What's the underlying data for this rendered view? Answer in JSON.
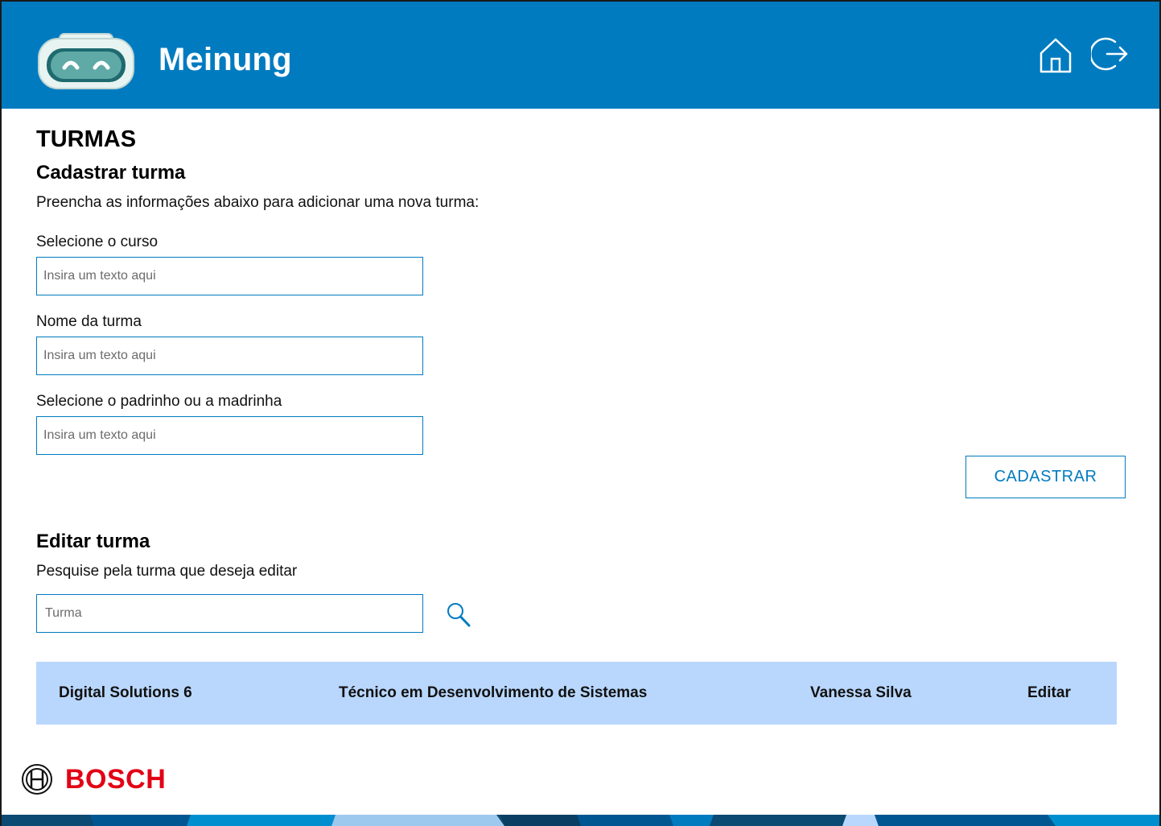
{
  "header": {
    "app_title": "Meinung",
    "home_icon": "home-icon",
    "logout_icon": "logout-icon",
    "background_color": "#007bc0"
  },
  "page": {
    "title": "TURMAS"
  },
  "register_section": {
    "title": "Cadastrar turma",
    "description": "Preencha as informações abaixo para adicionar uma nova turma:",
    "course_label": "Selecione o curso",
    "course_placeholder": "Insira um texto aqui",
    "class_name_label": "Nome da turma",
    "class_name_placeholder": "Insira um texto aqui",
    "sponsor_label": "Selecione o padrinho ou a madrinha",
    "sponsor_placeholder": "Insira um texto aqui",
    "submit_label": "CADASTRAR"
  },
  "edit_section": {
    "title": "Editar turma",
    "description": "Pesquise pela turma que deseja editar",
    "search_placeholder": "Turma",
    "search_icon": "search-icon",
    "results": [
      {
        "class_name": "Digital Solutions 6",
        "course": "Técnico em Desenvolvimento de Sistemas",
        "sponsor": "Vanessa Silva",
        "action": "Editar"
      }
    ]
  },
  "footer": {
    "brand": "BOSCH",
    "brand_color": "#e20015"
  },
  "colors": {
    "accent": "#007bc0",
    "row_background": "#b9d7fd"
  }
}
